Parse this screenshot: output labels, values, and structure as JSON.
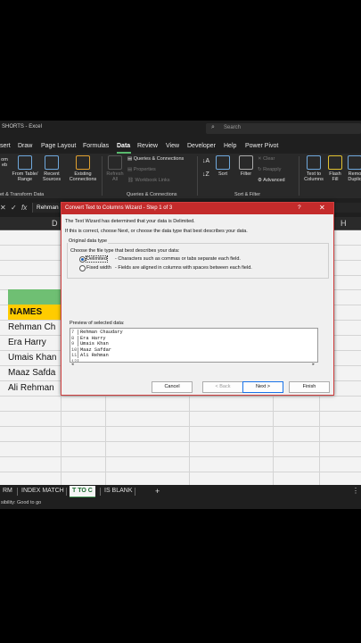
{
  "window": {
    "title": "SHORTS - Excel",
    "search_placeholder": "Search"
  },
  "menu": [
    "sert",
    "Draw",
    "Page Layout",
    "Formulas",
    "Data",
    "Review",
    "View",
    "Developer",
    "Help",
    "Power Pivot"
  ],
  "menu_active": "Data",
  "ribbon": {
    "get_transform": {
      "from_web": "om\neb",
      "from_table": "From Table/\nRange",
      "recent": "Recent\nSources",
      "existing": "Existing\nConnections",
      "label": "et & Transform Data"
    },
    "queries": {
      "refresh": "Refresh\nAll",
      "queries_connections": "Queries & Connections",
      "properties": "Properties",
      "workbook_links": "Workbook Links",
      "label": "Queries & Connections"
    },
    "sort_filter": {
      "sort": "Sort",
      "filter": "Filter",
      "clear": "Clear",
      "reapply": "Reapply",
      "advanced": "Advanced",
      "label": "Sort & Filter"
    },
    "data_tools": {
      "text_to_columns": "Text to\nColumns",
      "flash_fill": "Flash\nFill",
      "remove_duplicates": "Remo\nDuplic"
    }
  },
  "formula_bar": {
    "cancel": "✕",
    "enter": "✓",
    "fx": "fx",
    "content": "Rehman"
  },
  "columns": {
    "left": "D",
    "right": "H"
  },
  "sheet": {
    "header": "NAMES",
    "names": [
      "Rehman Ch",
      "Era Harry",
      "Umais Khan",
      "Maaz Safda",
      "Ali Rehman"
    ]
  },
  "dialog": {
    "title": "Convert Text to Columns Wizard - Step 1 of 3",
    "help": "?",
    "close": "✕",
    "intro1": "The Text Wizard has determined that your data is Delimited.",
    "intro2": "If this is correct, choose Next, or choose the data type that best describes your data.",
    "group_title": "Original data type",
    "choose": "Choose the file type that best describes your data:",
    "option_delimited": "Delimited",
    "desc_delimited": "- Characters such as commas or tabs separate each field.",
    "option_fixed": "Fixed width",
    "desc_fixed": "- Fields are aligned in columns with spaces between each field.",
    "selected": "Delimited",
    "preview_label": "Preview of selected data:",
    "preview_rows": [
      {
        "n": "7",
        "text": "Rehman Chaudary"
      },
      {
        "n": "8",
        "text": "Era Harry"
      },
      {
        "n": "9",
        "text": "Umais Khan"
      },
      {
        "n": "10",
        "text": "Maaz Safdar"
      },
      {
        "n": "11",
        "text": "Ali Rehman"
      },
      {
        "n": "12",
        "text": ""
      }
    ],
    "buttons": {
      "cancel": "Cancel",
      "back": "< Back",
      "next": "Next >",
      "finish": "Finish"
    }
  },
  "tabs": [
    "RM",
    "INDEX MATCH",
    "T TO C",
    "IS BLANK",
    "+"
  ],
  "tab_active": "T TO C",
  "status": "sibility: Good to go",
  "colors": {
    "accent": "#c42b2b",
    "green": "#6fbf73",
    "yellow": "#ffcc00"
  }
}
